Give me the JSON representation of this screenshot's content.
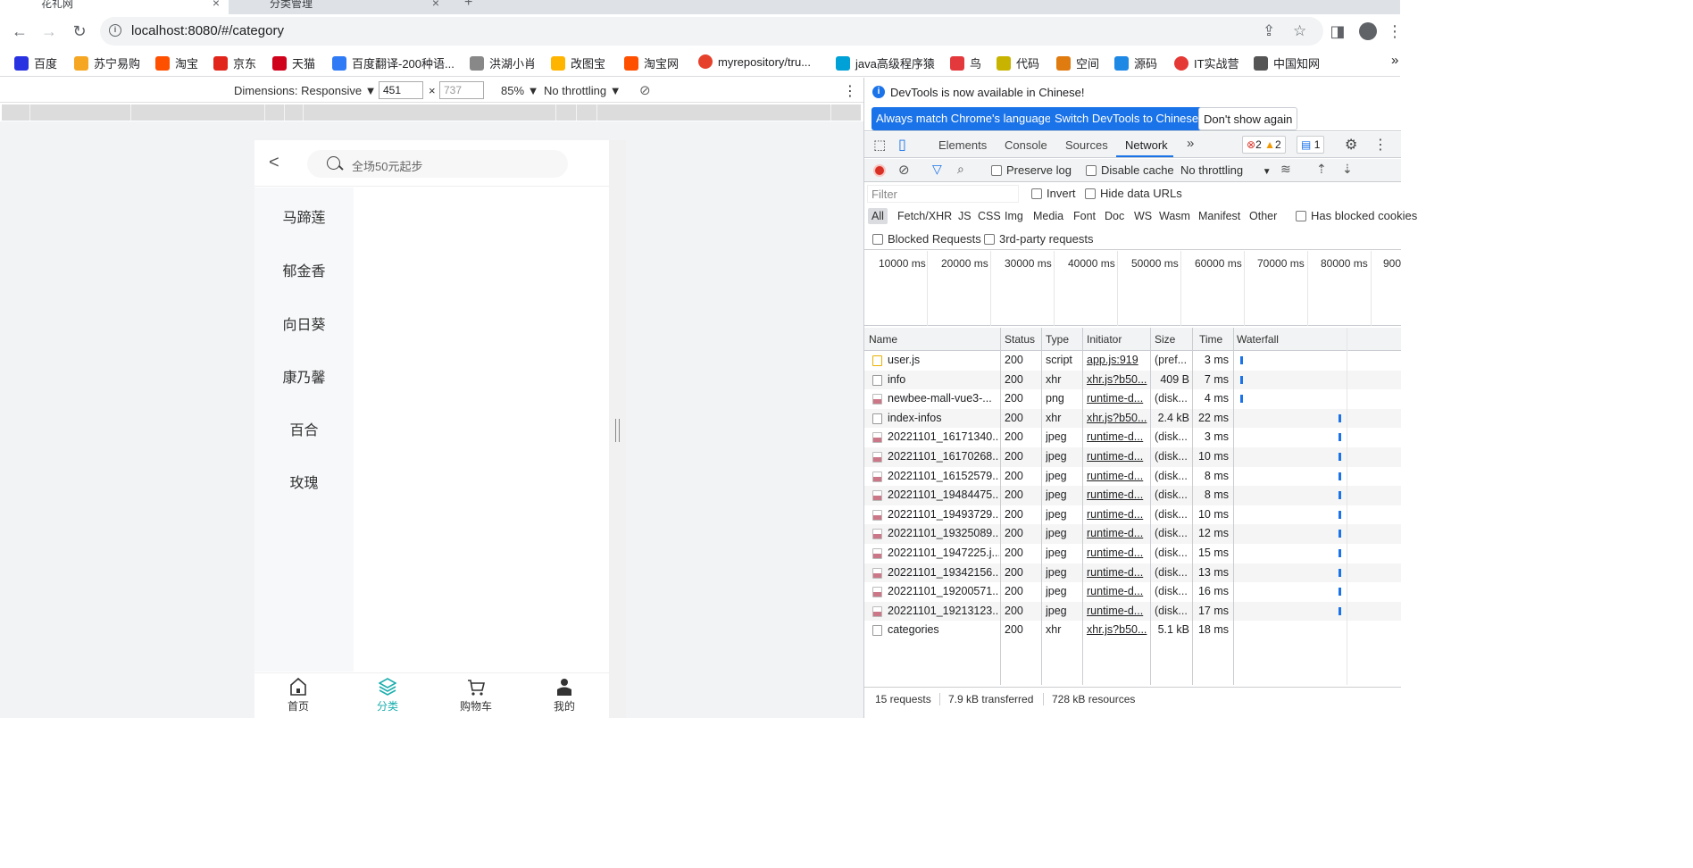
{
  "browser": {
    "tabs": [
      {
        "title": "花礼网",
        "close": "×"
      },
      {
        "title": "分类管理",
        "close": "×"
      }
    ],
    "new_tab": "+",
    "url": "localhost:8080/#/category",
    "bookmarks": [
      {
        "label": "百度",
        "color": "#2932e1"
      },
      {
        "label": "苏宁易购",
        "color": "#f5a623"
      },
      {
        "label": "淘宝",
        "color": "#ff5000"
      },
      {
        "label": "京东",
        "color": "#e1251b"
      },
      {
        "label": "天猫",
        "color": "#d0021b"
      },
      {
        "label": "百度翻译-200种语...",
        "color": "#2f7bf5"
      },
      {
        "label": "洪湖小肖",
        "color": "#888888"
      },
      {
        "label": "改图宝",
        "color": "#ffb400"
      },
      {
        "label": "淘宝网",
        "color": "#ff5000"
      },
      {
        "label": "myrepository/tru...",
        "color": "#e5412b"
      },
      {
        "label": "java高级程序猿",
        "color": "#00a1d6"
      },
      {
        "label": "鸟",
        "color": "#e4393c"
      },
      {
        "label": "代码",
        "color": "#c8b400"
      },
      {
        "label": "空间",
        "color": "#e07b10"
      },
      {
        "label": "源码",
        "color": "#1e88e5"
      },
      {
        "label": "IT实战营",
        "color": "#e53935"
      },
      {
        "label": "中国知网",
        "color": "#555555"
      }
    ],
    "bookmarks_more": "»"
  },
  "device_toolbar": {
    "dimensions": "Dimensions: Responsive ▼",
    "width": "451",
    "times": "×",
    "height": "737",
    "zoom": "85% ▼",
    "throttle": "No throttling ▼"
  },
  "mobile": {
    "back": "<",
    "search_placeholder": "全场50元起步",
    "categories": [
      "马蹄莲",
      "郁金香",
      "向日葵",
      "康乃馨",
      "百合",
      "玫瑰"
    ],
    "tabbar": [
      {
        "label": "首页"
      },
      {
        "label": "分类"
      },
      {
        "label": "购物车"
      },
      {
        "label": "我的"
      }
    ],
    "accent": "#1baeae"
  },
  "devtools": {
    "info_text": "DevTools is now available in Chinese!",
    "btn_match": "Always match Chrome's language",
    "btn_switch": "Switch DevTools to Chinese",
    "btn_dont": "Don't show again",
    "tabs": [
      "Elements",
      "Console",
      "Sources",
      "Network"
    ],
    "more_tabs": "»",
    "errors": "2",
    "warnings": "2",
    "messages": "1",
    "preserve_log": "Preserve log",
    "disable_cache": "Disable cache",
    "throttling": "No throttling",
    "filter_placeholder": "Filter",
    "invert": "Invert",
    "hide_data_urls": "Hide data URLs",
    "types": [
      "All",
      "Fetch/XHR",
      "JS",
      "CSS",
      "Img",
      "Media",
      "Font",
      "Doc",
      "WS",
      "Wasm",
      "Manifest",
      "Other"
    ],
    "has_blocked": "Has blocked cookies",
    "blocked_requests": "Blocked Requests",
    "third_party": "3rd-party requests",
    "timeline_labels": [
      "10000 ms",
      "20000 ms",
      "30000 ms",
      "40000 ms",
      "50000 ms",
      "60000 ms",
      "70000 ms",
      "80000 ms",
      "900"
    ],
    "columns": [
      "Name",
      "Status",
      "Type",
      "Initiator",
      "Size",
      "Time",
      "Waterfall"
    ],
    "requests": [
      {
        "name": "user.js",
        "status": "200",
        "type": "script",
        "initiator": "app.js:919",
        "size": "(pref...",
        "time": "3 ms",
        "icon": "js",
        "wf": 0.02
      },
      {
        "name": "info",
        "status": "200",
        "type": "xhr",
        "initiator": "xhr.js?b50...",
        "size": "409 B",
        "time": "7 ms",
        "icon": "doc",
        "wf": 0.02
      },
      {
        "name": "newbee-mall-vue3-...",
        "status": "200",
        "type": "png",
        "initiator": "runtime-d...",
        "size": "(disk...",
        "time": "4 ms",
        "icon": "img",
        "wf": 0.02
      },
      {
        "name": "index-infos",
        "status": "200",
        "type": "xhr",
        "initiator": "xhr.js?b50...",
        "size": "2.4 kB",
        "time": "22 ms",
        "icon": "doc",
        "wf": 0.66
      },
      {
        "name": "20221101_16171340...",
        "status": "200",
        "type": "jpeg",
        "initiator": "runtime-d...",
        "size": "(disk...",
        "time": "3 ms",
        "icon": "img",
        "wf": 0.66
      },
      {
        "name": "20221101_16170268...",
        "status": "200",
        "type": "jpeg",
        "initiator": "runtime-d...",
        "size": "(disk...",
        "time": "10 ms",
        "icon": "img",
        "wf": 0.66
      },
      {
        "name": "20221101_16152579...",
        "status": "200",
        "type": "jpeg",
        "initiator": "runtime-d...",
        "size": "(disk...",
        "time": "8 ms",
        "icon": "img",
        "wf": 0.66
      },
      {
        "name": "20221101_19484475...",
        "status": "200",
        "type": "jpeg",
        "initiator": "runtime-d...",
        "size": "(disk...",
        "time": "8 ms",
        "icon": "img",
        "wf": 0.66
      },
      {
        "name": "20221101_19493729...",
        "status": "200",
        "type": "jpeg",
        "initiator": "runtime-d...",
        "size": "(disk...",
        "time": "10 ms",
        "icon": "img",
        "wf": 0.66
      },
      {
        "name": "20221101_19325089...",
        "status": "200",
        "type": "jpeg",
        "initiator": "runtime-d...",
        "size": "(disk...",
        "time": "12 ms",
        "icon": "img",
        "wf": 0.66
      },
      {
        "name": "20221101_1947225.j...",
        "status": "200",
        "type": "jpeg",
        "initiator": "runtime-d...",
        "size": "(disk...",
        "time": "15 ms",
        "icon": "img",
        "wf": 0.66
      },
      {
        "name": "20221101_19342156...",
        "status": "200",
        "type": "jpeg",
        "initiator": "runtime-d...",
        "size": "(disk...",
        "time": "13 ms",
        "icon": "img",
        "wf": 0.66
      },
      {
        "name": "20221101_19200571...",
        "status": "200",
        "type": "jpeg",
        "initiator": "runtime-d...",
        "size": "(disk...",
        "time": "16 ms",
        "icon": "img",
        "wf": 0.66
      },
      {
        "name": "20221101_19213123...",
        "status": "200",
        "type": "jpeg",
        "initiator": "runtime-d...",
        "size": "(disk...",
        "time": "17 ms",
        "icon": "img",
        "wf": 0.66
      },
      {
        "name": "categories",
        "status": "200",
        "type": "xhr",
        "initiator": "xhr.js?b50...",
        "size": "5.1 kB",
        "time": "18 ms",
        "icon": "doc",
        "wf": null
      }
    ],
    "status_requests": "15 requests",
    "status_transferred": "7.9 kB transferred",
    "status_resources": "728 kB resources"
  }
}
